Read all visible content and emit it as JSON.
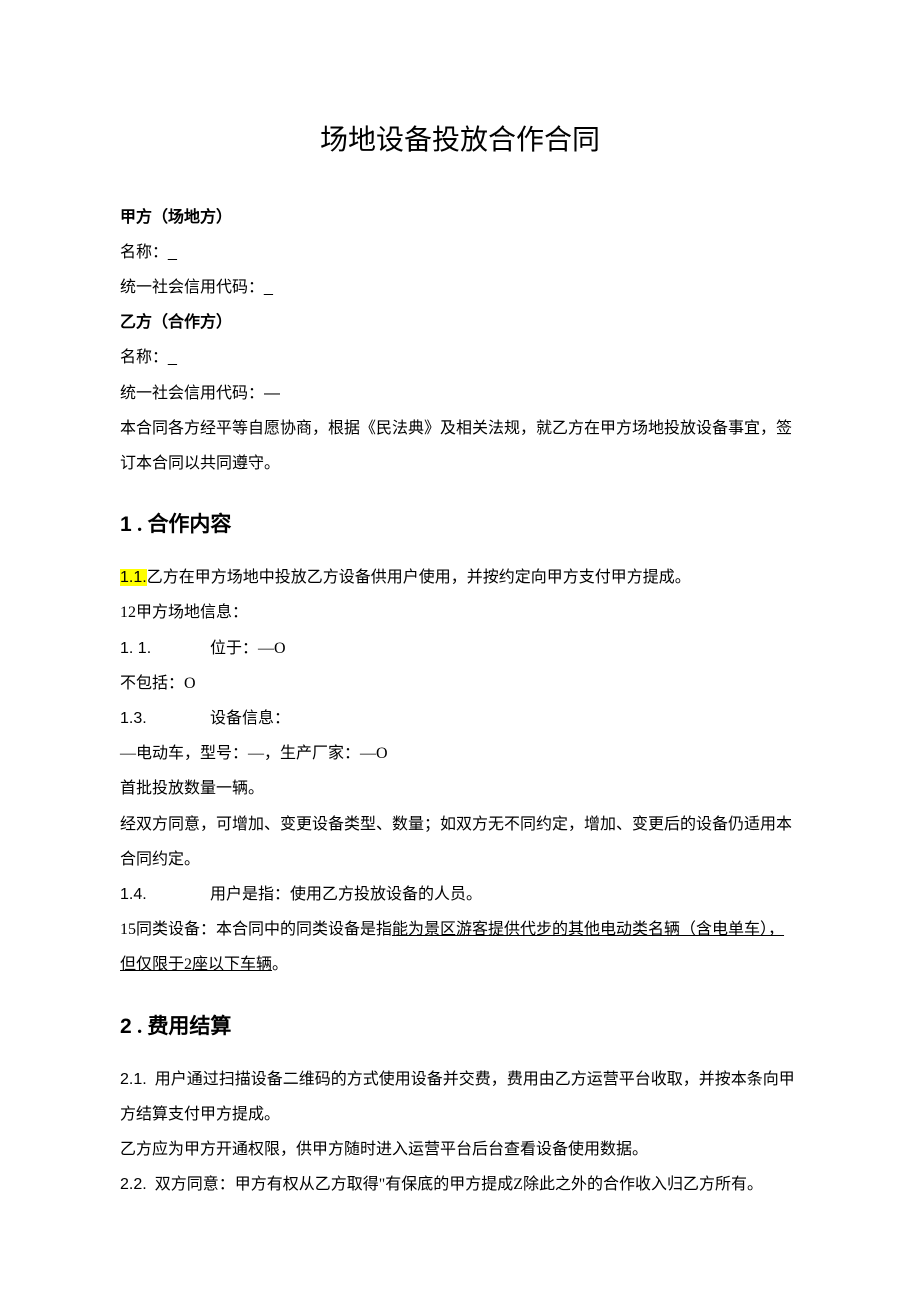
{
  "title": "场地设备投放合作合同",
  "partyA": {
    "header": "甲方（场地方）",
    "nameLabel": "名称：",
    "nameBlank": "_",
    "codeLabel": "统一社会信用代码：",
    "codeBlank": "_"
  },
  "partyB": {
    "header": "乙方（合作方）",
    "nameLabel": "名称：",
    "nameBlank": "_",
    "codeLabel": "统一社会信用代码：",
    "codeBlank": "—"
  },
  "preamble": "本合同各方经平等自愿协商，根据《民法典》及相关法规，就乙方在甲方场地投放设备事宜，签订本合同以共同遵守。",
  "section1": {
    "num": "1",
    "dot": " .",
    "title": "合作内容",
    "c11num": "1.1.",
    "c11text": "乙方在甲方场地中投放乙方设备供用户使用，并按约定向甲方支付甲方提成。",
    "c12": "12甲方场地信息：",
    "c11b_num": "1. 1.",
    "c11b_text": "位于：—O",
    "exclude": "不包括：O",
    "c13num": "1.3.",
    "c13text": "设备信息：",
    "vehicle": "—电动车，型号：—，生产厂家：—O",
    "batch": "首批投放数量一辆。",
    "change": "经双方同意，可增加、变更设备类型、数量；如双方无不同约定，增加、变更后的设备仍适用本合同约定。",
    "c14num": "1.4.",
    "c14text": "用户是指：使用乙方投放设备的人员。",
    "c15prefix": "15同类设备：本合同中的同类设备是指",
    "c15underline": "能为景区游客提供代步的其他电动类名辆（含电单车），但仅限于2座以下车辆",
    "c15suffix": "。"
  },
  "section2": {
    "num": "2",
    "dot": " .",
    "title": "费用结算",
    "c21num": "2.1.",
    "c21text": "用户通过扫描设备二维码的方式使用设备并交费，费用由乙方运营平台收取，并按本条向甲方结算支付甲方提成。",
    "c21b": "乙方应为甲方开通权限，供甲方随时进入运营平台后台查看设备使用数据。",
    "c22num": "2.2.",
    "c22text": "双方同意：甲方有权从乙方取得\"有保底的甲方提成Z除此之外的合作收入归乙方所有。"
  }
}
